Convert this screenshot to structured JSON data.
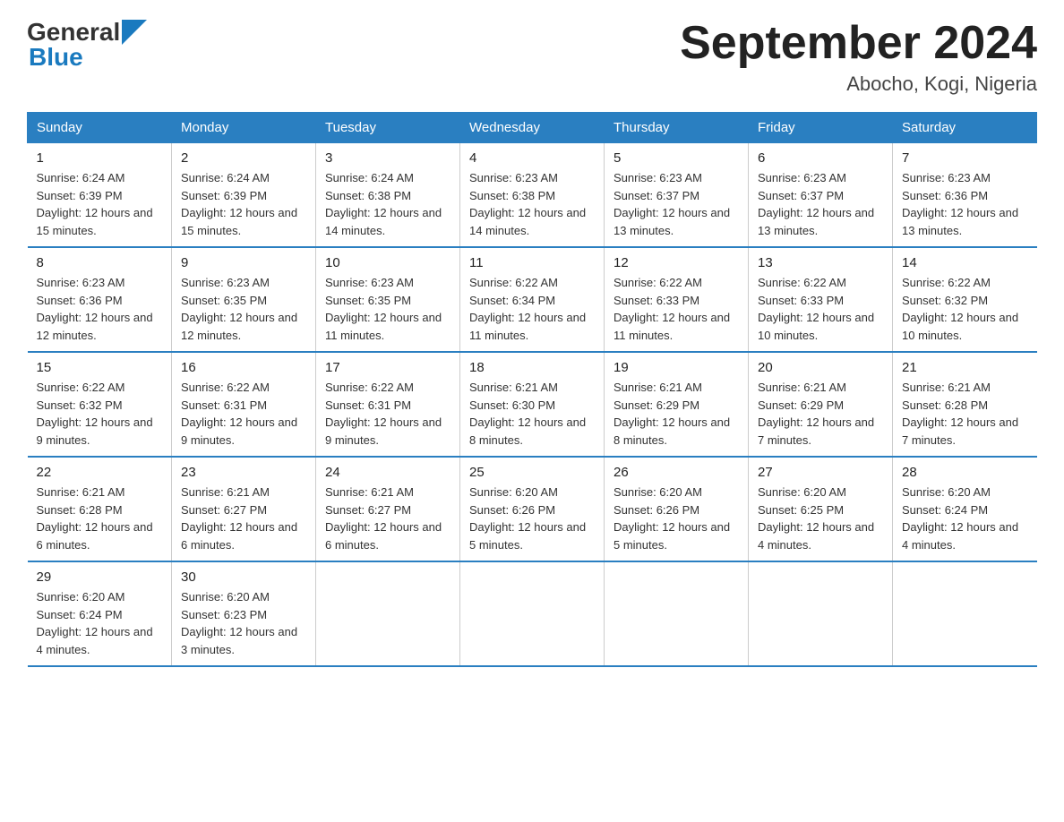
{
  "header": {
    "logo_general": "General",
    "logo_blue": "Blue",
    "month_year": "September 2024",
    "location": "Abocho, Kogi, Nigeria"
  },
  "days_of_week": [
    "Sunday",
    "Monday",
    "Tuesday",
    "Wednesday",
    "Thursday",
    "Friday",
    "Saturday"
  ],
  "weeks": [
    [
      {
        "day": "1",
        "sunrise": "6:24 AM",
        "sunset": "6:39 PM",
        "daylight": "12 hours and 15 minutes."
      },
      {
        "day": "2",
        "sunrise": "6:24 AM",
        "sunset": "6:39 PM",
        "daylight": "12 hours and 15 minutes."
      },
      {
        "day": "3",
        "sunrise": "6:24 AM",
        "sunset": "6:38 PM",
        "daylight": "12 hours and 14 minutes."
      },
      {
        "day": "4",
        "sunrise": "6:23 AM",
        "sunset": "6:38 PM",
        "daylight": "12 hours and 14 minutes."
      },
      {
        "day": "5",
        "sunrise": "6:23 AM",
        "sunset": "6:37 PM",
        "daylight": "12 hours and 13 minutes."
      },
      {
        "day": "6",
        "sunrise": "6:23 AM",
        "sunset": "6:37 PM",
        "daylight": "12 hours and 13 minutes."
      },
      {
        "day": "7",
        "sunrise": "6:23 AM",
        "sunset": "6:36 PM",
        "daylight": "12 hours and 13 minutes."
      }
    ],
    [
      {
        "day": "8",
        "sunrise": "6:23 AM",
        "sunset": "6:36 PM",
        "daylight": "12 hours and 12 minutes."
      },
      {
        "day": "9",
        "sunrise": "6:23 AM",
        "sunset": "6:35 PM",
        "daylight": "12 hours and 12 minutes."
      },
      {
        "day": "10",
        "sunrise": "6:23 AM",
        "sunset": "6:35 PM",
        "daylight": "12 hours and 11 minutes."
      },
      {
        "day": "11",
        "sunrise": "6:22 AM",
        "sunset": "6:34 PM",
        "daylight": "12 hours and 11 minutes."
      },
      {
        "day": "12",
        "sunrise": "6:22 AM",
        "sunset": "6:33 PM",
        "daylight": "12 hours and 11 minutes."
      },
      {
        "day": "13",
        "sunrise": "6:22 AM",
        "sunset": "6:33 PM",
        "daylight": "12 hours and 10 minutes."
      },
      {
        "day": "14",
        "sunrise": "6:22 AM",
        "sunset": "6:32 PM",
        "daylight": "12 hours and 10 minutes."
      }
    ],
    [
      {
        "day": "15",
        "sunrise": "6:22 AM",
        "sunset": "6:32 PM",
        "daylight": "12 hours and 9 minutes."
      },
      {
        "day": "16",
        "sunrise": "6:22 AM",
        "sunset": "6:31 PM",
        "daylight": "12 hours and 9 minutes."
      },
      {
        "day": "17",
        "sunrise": "6:22 AM",
        "sunset": "6:31 PM",
        "daylight": "12 hours and 9 minutes."
      },
      {
        "day": "18",
        "sunrise": "6:21 AM",
        "sunset": "6:30 PM",
        "daylight": "12 hours and 8 minutes."
      },
      {
        "day": "19",
        "sunrise": "6:21 AM",
        "sunset": "6:29 PM",
        "daylight": "12 hours and 8 minutes."
      },
      {
        "day": "20",
        "sunrise": "6:21 AM",
        "sunset": "6:29 PM",
        "daylight": "12 hours and 7 minutes."
      },
      {
        "day": "21",
        "sunrise": "6:21 AM",
        "sunset": "6:28 PM",
        "daylight": "12 hours and 7 minutes."
      }
    ],
    [
      {
        "day": "22",
        "sunrise": "6:21 AM",
        "sunset": "6:28 PM",
        "daylight": "12 hours and 6 minutes."
      },
      {
        "day": "23",
        "sunrise": "6:21 AM",
        "sunset": "6:27 PM",
        "daylight": "12 hours and 6 minutes."
      },
      {
        "day": "24",
        "sunrise": "6:21 AM",
        "sunset": "6:27 PM",
        "daylight": "12 hours and 6 minutes."
      },
      {
        "day": "25",
        "sunrise": "6:20 AM",
        "sunset": "6:26 PM",
        "daylight": "12 hours and 5 minutes."
      },
      {
        "day": "26",
        "sunrise": "6:20 AM",
        "sunset": "6:26 PM",
        "daylight": "12 hours and 5 minutes."
      },
      {
        "day": "27",
        "sunrise": "6:20 AM",
        "sunset": "6:25 PM",
        "daylight": "12 hours and 4 minutes."
      },
      {
        "day": "28",
        "sunrise": "6:20 AM",
        "sunset": "6:24 PM",
        "daylight": "12 hours and 4 minutes."
      }
    ],
    [
      {
        "day": "29",
        "sunrise": "6:20 AM",
        "sunset": "6:24 PM",
        "daylight": "12 hours and 4 minutes."
      },
      {
        "day": "30",
        "sunrise": "6:20 AM",
        "sunset": "6:23 PM",
        "daylight": "12 hours and 3 minutes."
      },
      null,
      null,
      null,
      null,
      null
    ]
  ],
  "labels": {
    "sunrise": "Sunrise:",
    "sunset": "Sunset:",
    "daylight": "Daylight:"
  }
}
